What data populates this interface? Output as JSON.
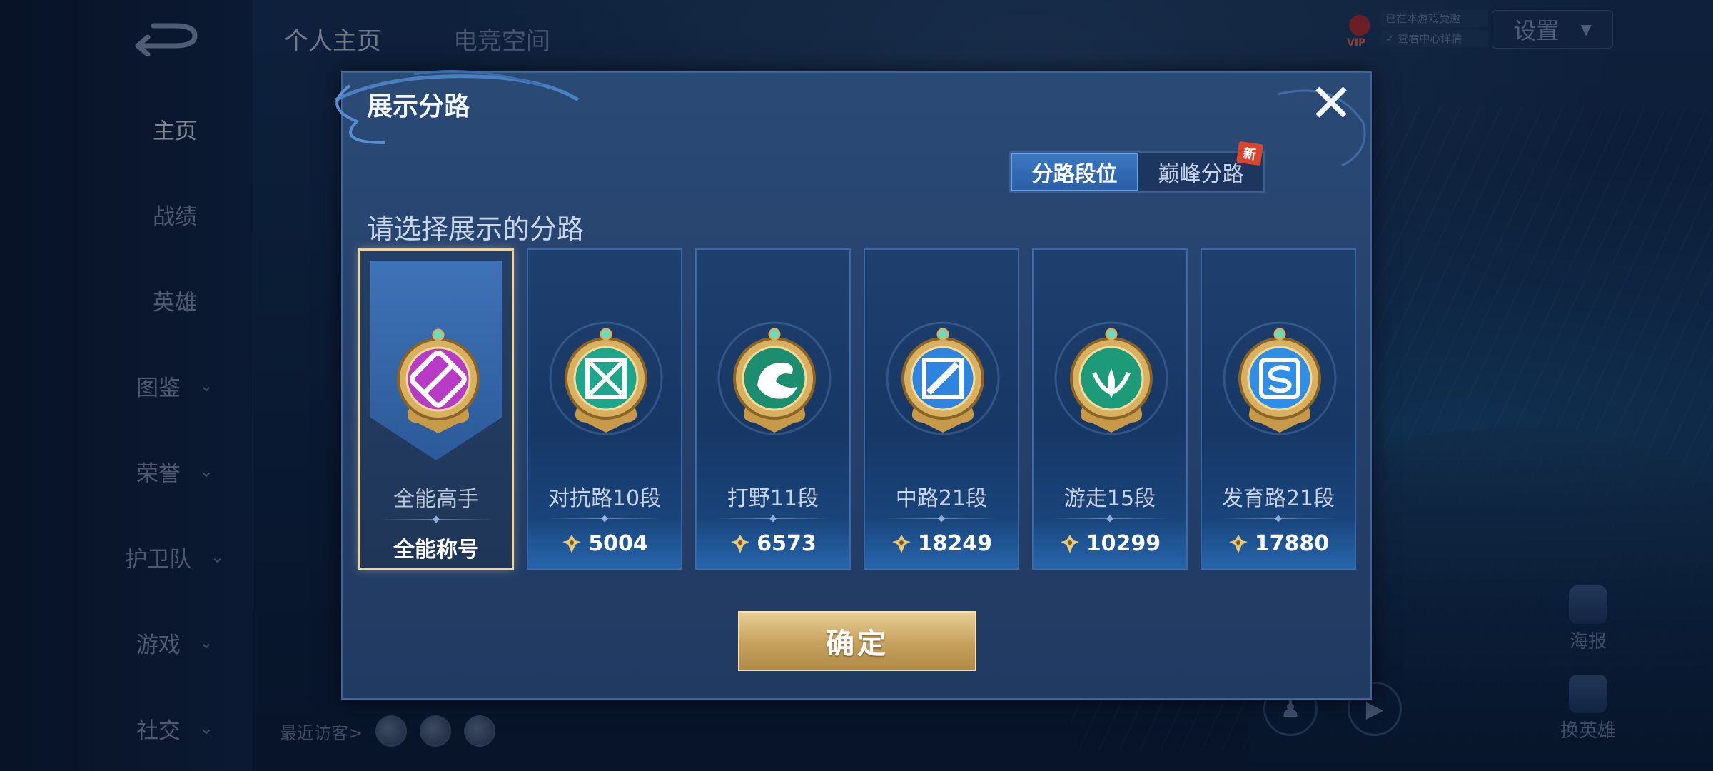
{
  "background": {
    "top_tabs": [
      "个人主页",
      "电竞空间"
    ],
    "settings_label": "设置",
    "vip": {
      "badge": "VIP",
      "line1": "已在本游戏受邀",
      "line2": "✓ 查看中心详情"
    },
    "nav": [
      {
        "label": "主页",
        "arrow": false,
        "active": true
      },
      {
        "label": "战绩",
        "arrow": false,
        "active": false
      },
      {
        "label": "英雄",
        "arrow": false,
        "active": false
      },
      {
        "label": "图鉴",
        "arrow": true,
        "active": false
      },
      {
        "label": "荣誉",
        "arrow": true,
        "active": false
      },
      {
        "label": "护卫队",
        "arrow": true,
        "active": false
      },
      {
        "label": "游戏",
        "arrow": true,
        "active": false
      },
      {
        "label": "社交",
        "arrow": true,
        "active": false
      }
    ],
    "recent_visitors_label": "最近访客>",
    "side_buttons": [
      "海报",
      "换英雄"
    ],
    "arrow_glyph": "⌄"
  },
  "dialog": {
    "title": "展示分路",
    "close_glyph": "✕",
    "toggle": {
      "options": [
        "分路段位",
        "巅峰分路"
      ],
      "selected_index": 0,
      "new_badge": "新"
    },
    "prompt": "请选择展示的分路",
    "cards": [
      {
        "name": "全能高手",
        "value": "全能称号",
        "selected": true,
        "emblem_color": "#b73bc4",
        "icon": "all-round-icon"
      },
      {
        "name": "对抗路10段",
        "value": "5004",
        "selected": false,
        "emblem_color": "#1fa58a",
        "icon": "clash-lane-icon"
      },
      {
        "name": "打野11段",
        "value": "6573",
        "selected": false,
        "emblem_color": "#1c8d6e",
        "icon": "jungle-icon"
      },
      {
        "name": "中路21段",
        "value": "18249",
        "selected": false,
        "emblem_color": "#2f84e0",
        "icon": "mid-lane-icon"
      },
      {
        "name": "游走15段",
        "value": "10299",
        "selected": false,
        "emblem_color": "#1d9a78",
        "icon": "roam-icon"
      },
      {
        "name": "发育路21段",
        "value": "17880",
        "selected": false,
        "emblem_color": "#2f8ee6",
        "icon": "farm-lane-icon"
      }
    ],
    "confirm_label": "确定",
    "colors": {
      "accent_gold": "#f0d49a",
      "panel": "#2a4a76",
      "active_tab": "#3b78c2"
    }
  }
}
